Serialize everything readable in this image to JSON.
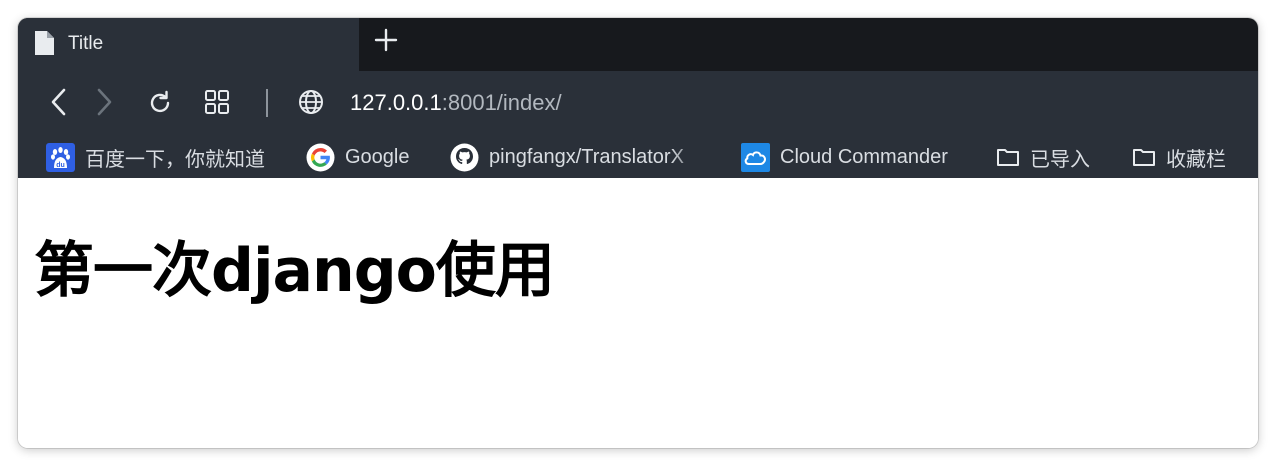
{
  "tab": {
    "title": "Title"
  },
  "address_bar": {
    "host": "127.0.0.1",
    "rest": ":8001/index/"
  },
  "bookmarks": [
    {
      "label": "百度一下，你就知道",
      "icon": "baidu-icon"
    },
    {
      "label": "Google",
      "icon": "google-icon"
    },
    {
      "label": "pingfangx/TranslatorX",
      "icon": "github-icon"
    },
    {
      "label": "Cloud Commander",
      "icon": "cloud-icon"
    },
    {
      "label": "已导入",
      "icon": "folder-icon"
    },
    {
      "label": "收藏栏",
      "icon": "folder-icon"
    }
  ],
  "page": {
    "heading": "第一次django使用"
  },
  "colors": {
    "tabbar_bg": "#17191d",
    "toolbar_bg": "#2a3039",
    "text_light": "#e9ecef"
  }
}
